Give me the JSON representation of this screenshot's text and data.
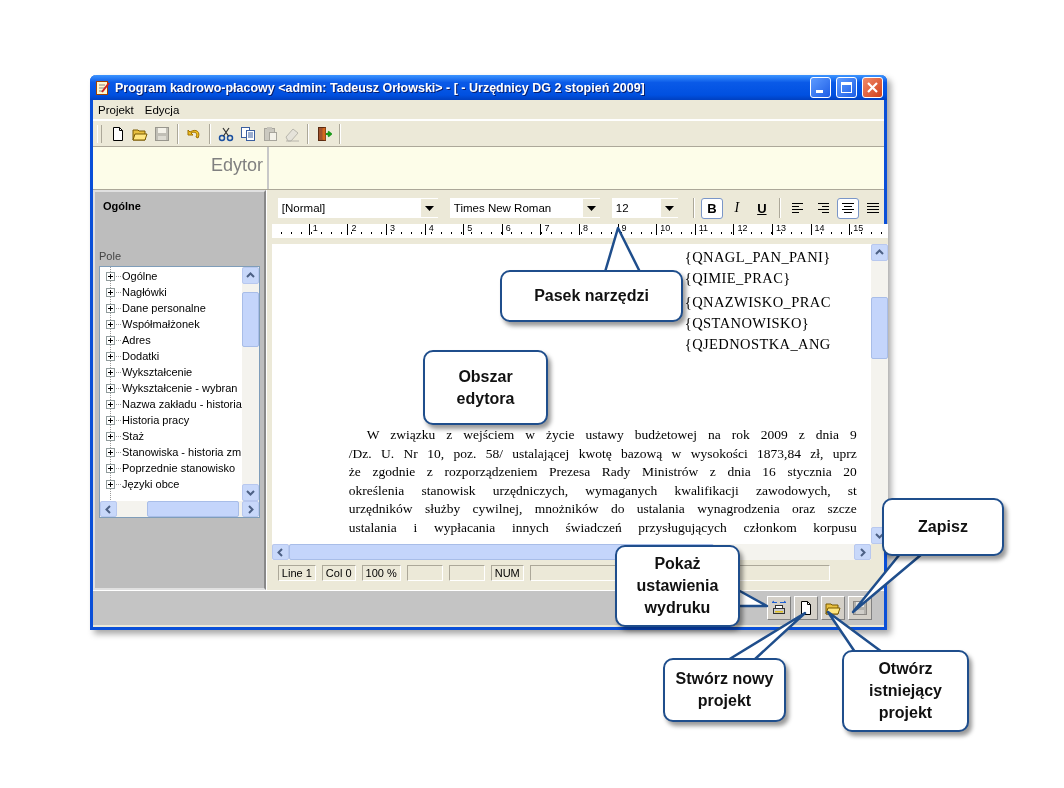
{
  "window": {
    "title": "Program kadrowo-płacowy <admin: Tadeusz Orłowski> - [ - Urzędnicy DG 2 stopień 2009]"
  },
  "menu": [
    "Projekt",
    "Edycja"
  ],
  "toolbar": [
    [
      {
        "kind": "new",
        "disabled": false
      },
      {
        "kind": "open",
        "disabled": false
      },
      {
        "kind": "save",
        "disabled": true
      }
    ],
    [
      {
        "kind": "undo",
        "disabled": false
      }
    ],
    [
      {
        "kind": "cut",
        "disabled": false
      },
      {
        "kind": "copy",
        "disabled": false
      },
      {
        "kind": "paste",
        "disabled": true
      },
      {
        "kind": "clear",
        "disabled": true
      }
    ],
    [
      {
        "kind": "exit",
        "disabled": false
      }
    ]
  ],
  "header": {
    "title": "Edytor"
  },
  "left_panel": {
    "heading": "Ogólne",
    "field_label": "Pole",
    "tree": [
      {
        "label": "Ogólne",
        "expanded": false
      },
      {
        "label": "Nagłówki",
        "expanded": false
      },
      {
        "label": "Dane personalne",
        "expanded": false
      },
      {
        "label": "Współmałżonek",
        "expanded": false
      },
      {
        "label": "Adres",
        "expanded": false
      },
      {
        "label": "Dodatki",
        "expanded": false
      },
      {
        "label": "Wykształcenie",
        "expanded": false
      },
      {
        "label": "Wykształcenie - wybran",
        "expanded": false
      },
      {
        "label": "Nazwa zakładu - historia",
        "expanded": false
      },
      {
        "label": "Historia pracy",
        "expanded": false
      },
      {
        "label": "Staż",
        "expanded": false
      },
      {
        "label": "Stanowiska - historia zm",
        "expanded": false
      },
      {
        "label": "Poprzednie stanowisko",
        "expanded": false
      },
      {
        "label": "Języki obce",
        "expanded": false
      }
    ]
  },
  "editor": {
    "style": "[Normal]",
    "font": "Times New Roman",
    "size": "12",
    "format_buttons": [
      {
        "kind": "bold",
        "label": "B",
        "pressed": true
      },
      {
        "kind": "italic",
        "label": "I",
        "pressed": false
      },
      {
        "kind": "underline",
        "label": "U",
        "pressed": false
      }
    ],
    "align_buttons": [
      {
        "kind": "align-left",
        "pressed": false
      },
      {
        "kind": "align-right",
        "pressed": false
      },
      {
        "kind": "align-center",
        "pressed": true
      },
      {
        "kind": "justify",
        "pressed": false
      }
    ],
    "ruler": [
      "1",
      "2",
      "3",
      "4",
      "5",
      "6",
      "7",
      "8",
      "9",
      "10",
      "11",
      "12",
      "13",
      "14",
      "15"
    ],
    "fields": [
      "{QNAGL_PAN_PANI}",
      "{QIMIE_PRAC}",
      "{QNAZWISKO_PRAC",
      "{QSTANOWISKO}",
      "{QJEDNOSTKA_ANG"
    ],
    "paragraph": [
      "W związku z wejściem w życie ustawy budżetowej na rok 2009 z dnia 9",
      "/Dz. U. Nr 10, poz. 58/ ustalającej kwotę bazową w wysokości 1873,84 zł, uprz",
      "że zgodnie z rozporządzeniem Prezesa Rady Ministrów z dnia 16 stycznia 20",
      "określenia stanowisk urzędniczych, wymaganych kwalifikacji zawodowych, st",
      "urzędników służby cywilnej, mnożników do ustalania wynagrodzenia oraz szcze",
      "ustalania i wypłacania innych świadczeń przysługujących członkom korpusu"
    ]
  },
  "status_bar": [
    {
      "kind": "text",
      "text": "Line 1"
    },
    {
      "kind": "text",
      "text": "Col 0"
    },
    {
      "kind": "text",
      "text": "100 %"
    },
    {
      "kind": "blank"
    },
    {
      "kind": "blank"
    },
    {
      "kind": "text",
      "text": "NUM"
    },
    {
      "kind": "blank"
    }
  ],
  "bottom_buttons": [
    {
      "kind": "print-setup",
      "disabled": false
    },
    {
      "kind": "new",
      "disabled": false
    },
    {
      "kind": "open",
      "disabled": false
    },
    {
      "kind": "save",
      "disabled": true
    }
  ],
  "callouts": [
    {
      "text": "Pasek narzędzi",
      "pointer": true
    },
    {
      "text": "Obszar edytora",
      "pointer": false
    },
    {
      "text": "Zapisz",
      "pointer": true
    },
    {
      "text": "Pokaż ustawienia wydruku",
      "pointer": true
    },
    {
      "text": "Stwórz nowy projekt",
      "pointer": true
    },
    {
      "text": "Otwórz istniejący projekt",
      "pointer": true
    }
  ]
}
